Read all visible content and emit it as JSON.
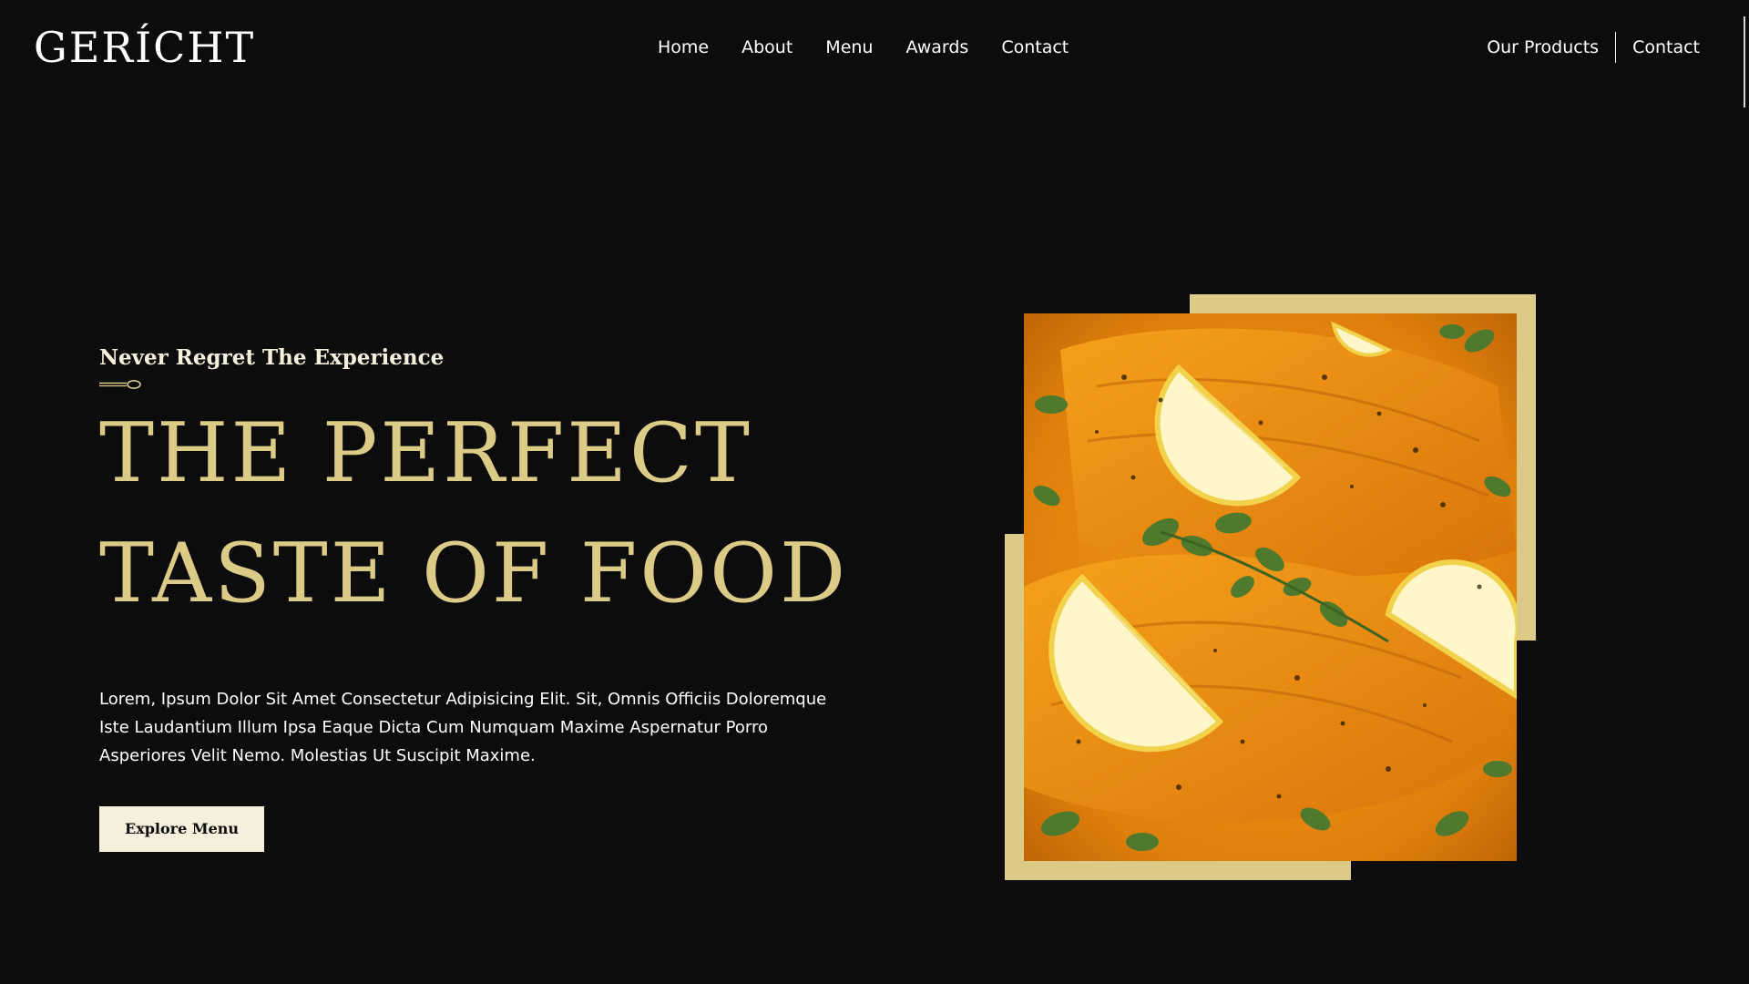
{
  "brand": {
    "logo_text": "GERÍCHT"
  },
  "nav": {
    "links": [
      "Home",
      "About",
      "Menu",
      "Awards",
      "Contact"
    ],
    "right": {
      "products_label": "Our Products",
      "contact_label": "Contact"
    }
  },
  "hero": {
    "subtitle": "Never Regret The Experience",
    "headline_line1": "THE PERFECT",
    "headline_line2": "TASTE OF FOOD",
    "description": "Lorem, Ipsum Dolor Sit Amet Consectetur Adipisicing Elit. Sit, Omnis Officiis Doloremque Iste Laudantium Illum Ipsa Eaque Dicta Cum Numquam Maxime Aspernatur Porro Asperiores Velit Nemo. Molestias Ut Suscipit Maxime.",
    "cta_label": "Explore Menu"
  },
  "icons": {
    "spoon": "spoon-divider-icon"
  },
  "colors": {
    "background": "#0c0c0c",
    "gold": "#dcca87",
    "cream": "#f5efdb",
    "white": "#ffffff"
  }
}
